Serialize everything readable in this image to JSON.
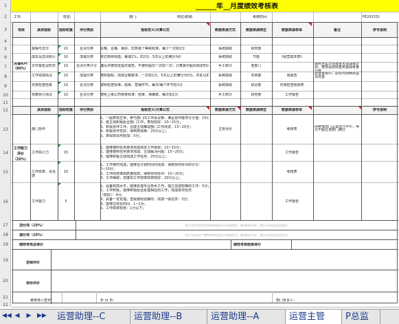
{
  "sheet": {
    "title": "______年__月度绩效考核表",
    "info": {
      "name": "工号:",
      "dept": "姓名:",
      "section": "部门:",
      "position": "岗位/职级:",
      "jobno": "考核时间:",
      "date": "FE201531"
    },
    "headers": [
      "项目",
      "具体指标",
      "指标权重",
      "评分类别",
      "指标定义/计算公式",
      "数据来源方式",
      "数据来源岗位",
      "数据来源表单",
      "备注",
      "序号说明"
    ],
    "kpi_group": "关键KPI（80%）",
    "kpi_rows": [
      {
        "name": "报销与支付",
        "weight": "10",
        "type": "否决分类",
        "def": "及格、合格、良好、优秀各个等级标准，每少一次扣1分",
        "src": "系统获取",
        "pos": "财务部"
      },
      {
        "name": "成本及支出执行",
        "weight": "10",
        "type": "加减分类",
        "def": "未达到目标值，每减1%，扣2分，5次以上扣满分为0",
        "src": "系统获取",
        "pos": "节能",
        "form": "《经营成本表》"
      },
      {
        "name": "文件报告及时交",
        "weight": "10",
        "type": "否决分类计分",
        "def": "编写并按规定提交报告，不按照提交一次扣一次，计算其中超出规定时间数",
        "src": "手工统计",
        "pos": "各部门",
        "note": "按照全年计划按各大块填报计划，按预设绩效各类基础考量分数"
      },
      {
        "name": "工作完成情况",
        "weight": "10",
        "type": "加减分类",
        "def": "按照指标，完成合格要求，一次扣1分，5次以上扣满分为0分，并处以扣除对应的合格奖励",
        "src": "系统获取",
        "pos": "项目部",
        "form": "周报告",
        "note": "月度考核中，原则为持续改善及完善"
      },
      {
        "name": "日常检查结果",
        "weight": "10",
        "type": "否决分类",
        "def": "按照检查标准，结果、营销环节，每次/每个环节扣1分",
        "src": "系统获取",
        "pos": "综合部",
        "form": "日常检查结果表"
      },
      {
        "name": "预算执行情况",
        "weight": "10",
        "type": "否决分类",
        "def": "按照上级公司考核标准：结果、准确率、每次扣1分",
        "src": "手工统计",
        "pos": "财务部",
        "form": "工作报告"
      }
    ],
    "ability_group": "工作能力评价（20%）",
    "ability_headers": [
      "数据来源方式",
      "数据来源岗位",
      "数据来源表单",
      "序号说明"
    ],
    "ability_rows": [
      {
        "name": "部门协作",
        "weight": "",
        "lines": [
          "1、一般表现正常，参与部门内工作会议等，满足协作要求计分值：10分；",
          "2、能主动积极配合部门工作，表现较好：10~15分；",
          "3、积极协作工作，且能主动推动部门工作改进：15~20分；",
          "4、积极协作性好，得到表扬等：20分以上；",
          "5、表现突出可酌加：5分；"
        ],
        "src": "主管评价",
        "form": "考核表",
        "note": "由被考部门主管进行评价，得分不超过该部门满分"
      },
      {
        "name": "工作执行力",
        "weight": "15",
        "lines": [
          "1、能够按照任务要求完成预定工作目标：10~15分；",
          "2、能够按照任务要求完成、主动解决问题：15~20分；",
          "3、能够积极主动完成工作任务：20分以上；"
        ],
        "form": "工作报告"
      },
      {
        "name": "工作效率、责任感",
        "weight": "10",
        "lines": [
          "1、工作按时完成，能够在计划时间内完成：得到领导好评的计分：",
          "0~10分；",
          "2、工作的效率和质量较高，得到领导好评：10~20分；",
          "3、工作细致，态度的工作效率较高较好：20分以上；"
        ],
        "form": "考核表"
      },
      {
        "name": "工作能力",
        "weight": "5",
        "lines": [
          "1、具备较高水平，能够处理专业技术工作，独立完成较难的工作：5分；",
          "2、工作积极，能够积极配合处理相应的工作，完成各项任务",
          "（较好）：4分；",
          "3、具备一定处理，但需要经验辅导，完成一般任务：3分；",
          "4、能够在较长时间：1~2分；",
          "5、工作效率较低：1分以下；"
        ],
        "form": "工作报告"
      }
    ],
    "add_score_label": "加分项（10%）",
    "add_score_text": "对公司作出突出贡献或获得公司表扬的，最高加10分，由公司决定是否加分",
    "minus_score_label": "减分项（10%）",
    "minus_score_text": "对公司造成严重损失或违反公司规定的，最高扣10分，由公司决定是否扣分",
    "final_label": "绩效考核总得分",
    "final_result_label": "绩效考核结果得分",
    "self_eval": "自我评价",
    "leader_eval": "领导评价",
    "sign_left": "被考核人签字：",
    "sign_mid": "年  月  日：",
    "sign_right": "部门负责人："
  },
  "tabs": [
    {
      "label": "运营助理--C",
      "active": false
    },
    {
      "label": "运营助理--B",
      "active": false
    },
    {
      "label": "运营助理--A",
      "active": false
    },
    {
      "label": "运营主管",
      "active": true
    },
    {
      "label": "P总监",
      "active": false
    }
  ],
  "nav": {
    "first": "◀◀",
    "prev": "◀",
    "next": "▶",
    "last": "▶▶"
  },
  "colors": {
    "yellow": "#ffff00",
    "header_row": "#ececec",
    "tab_text": "#1a3a8a"
  }
}
